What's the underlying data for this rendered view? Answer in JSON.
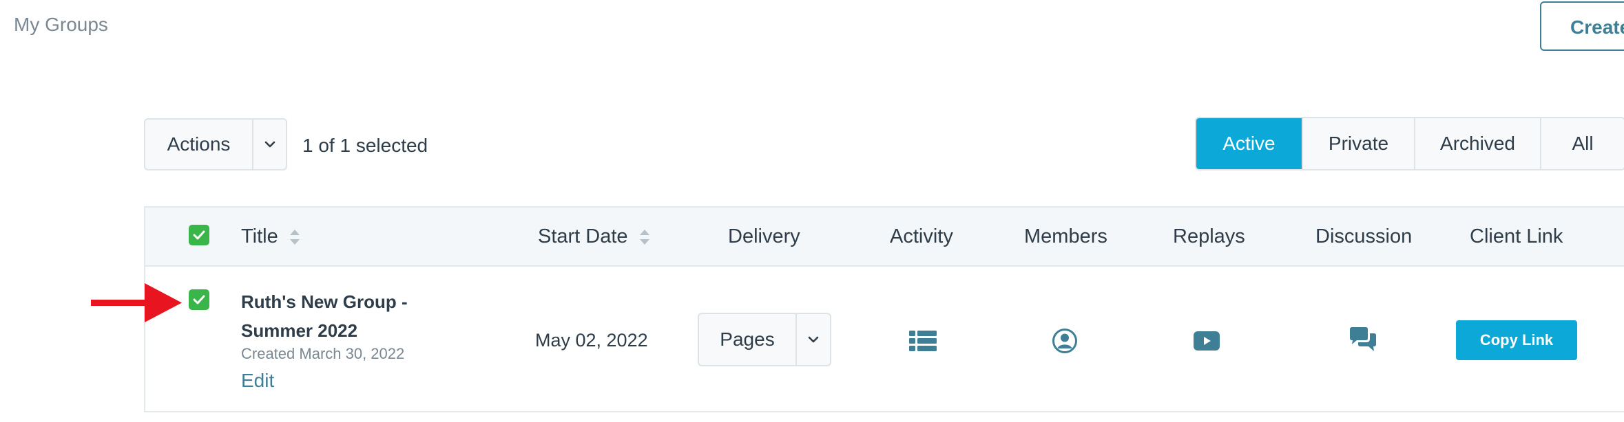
{
  "header": {
    "page_title": "My Groups",
    "create_label": "Create"
  },
  "toolbar": {
    "actions_label": "Actions",
    "selection_text": "1 of 1 selected"
  },
  "filters": {
    "tabs": [
      {
        "label": "Active",
        "active": true
      },
      {
        "label": "Private",
        "active": false
      },
      {
        "label": "Archived",
        "active": false
      },
      {
        "label": "All",
        "active": false
      }
    ]
  },
  "table": {
    "columns": {
      "title": "Title",
      "start_date": "Start Date",
      "delivery": "Delivery",
      "activity": "Activity",
      "members": "Members",
      "replays": "Replays",
      "discussion": "Discussion",
      "client_link": "Client Link"
    },
    "rows": [
      {
        "selected": true,
        "title_line1": "Ruth's New Group -",
        "title_line2": "Summer 2022",
        "created": "Created March 30, 2022",
        "edit_label": "Edit",
        "start_date": "May 02, 2022",
        "delivery_value": "Pages",
        "activity_icon": "list-icon",
        "members_icon": "user-circle-icon",
        "replays_icon": "video-play-icon",
        "discussion_icon": "chat-bubbles-icon",
        "copy_link_label": "Copy Link"
      }
    ]
  },
  "colors": {
    "accent": "#0ca8d8",
    "checkbox_green": "#39b54a",
    "icon_teal": "#3f7f96",
    "annotation_arrow": "#e8141f"
  }
}
